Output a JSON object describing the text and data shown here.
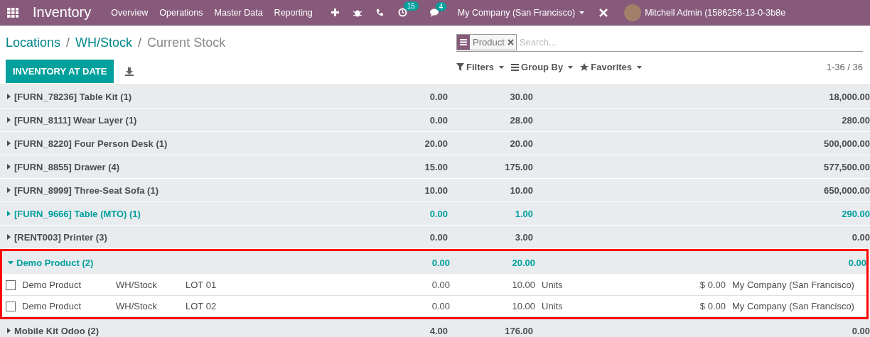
{
  "navbar": {
    "app_title": "Inventory",
    "menu": [
      "Overview",
      "Operations",
      "Master Data",
      "Reporting"
    ],
    "activity_count": "15",
    "message_count": "4",
    "company": "My Company (San Francisco)",
    "user": "Mitchell Admin (1586256-13-0-3b8e"
  },
  "breadcrumb": {
    "links": [
      "Locations",
      "WH/Stock"
    ],
    "separator": "/",
    "current": "Current Stock"
  },
  "search": {
    "facet": "Product",
    "placeholder": "Search..."
  },
  "buttons": {
    "primary": "INVENTORY AT DATE"
  },
  "filters": [
    "Filters",
    "Group By",
    "Favorites"
  ],
  "pager": "1-36 / 36",
  "groups": [
    {
      "name": "[FURN_78236] Table Kit (1)",
      "color": "#4c4c4c",
      "expanded": false,
      "values": [
        "0.00",
        "30.00",
        "18,000.00"
      ]
    },
    {
      "name": "[FURN_8111] Wear Layer (1)",
      "color": "#4c4c4c",
      "expanded": false,
      "values": [
        "0.00",
        "28.00",
        "280.00"
      ]
    },
    {
      "name": "[FURN_8220] Four Person Desk (1)",
      "color": "#4c4c4c",
      "expanded": false,
      "values": [
        "20.00",
        "20.00",
        "500,000.00"
      ]
    },
    {
      "name": "[FURN_8855] Drawer (4)",
      "color": "#4c4c4c",
      "expanded": false,
      "values": [
        "15.00",
        "175.00",
        "577,500.00"
      ]
    },
    {
      "name": "[FURN_8999] Three-Seat Sofa (1)",
      "color": "#4c4c4c",
      "expanded": false,
      "values": [
        "10.00",
        "10.00",
        "650,000.00"
      ]
    },
    {
      "name": "[FURN_9666] Table (MTO) (1)",
      "color": "#00a09d",
      "expanded": false,
      "values": [
        "0.00",
        "1.00",
        "290.00"
      ]
    },
    {
      "name": "[RENT003] Printer (3)",
      "color": "#4c4c4c",
      "expanded": false,
      "values": [
        "0.00",
        "3.00",
        "0.00"
      ]
    },
    {
      "name": "Demo Product (2)",
      "color": "#00a09d",
      "expanded": true,
      "highlighted": true,
      "values": [
        "0.00",
        "20.00",
        "0.00"
      ],
      "records": [
        {
          "checked": false,
          "product": "Demo Product",
          "location": "WH/Stock",
          "lot": "LOT 01",
          "reserved": "0.00",
          "quantity": "10.00",
          "uom": "Units",
          "value": "$ 0.00",
          "company": "My Company (San Francisco)"
        },
        {
          "checked": false,
          "product": "Demo Product",
          "location": "WH/Stock",
          "lot": "LOT 02",
          "reserved": "0.00",
          "quantity": "10.00",
          "uom": "Units",
          "value": "$ 0.00",
          "company": "My Company (San Francisco)"
        }
      ]
    },
    {
      "name": "Mobile Kit Odoo (2)",
      "color": "#4c4c4c",
      "expanded": false,
      "values": [
        "4.00",
        "176.00",
        "0.00"
      ]
    }
  ]
}
